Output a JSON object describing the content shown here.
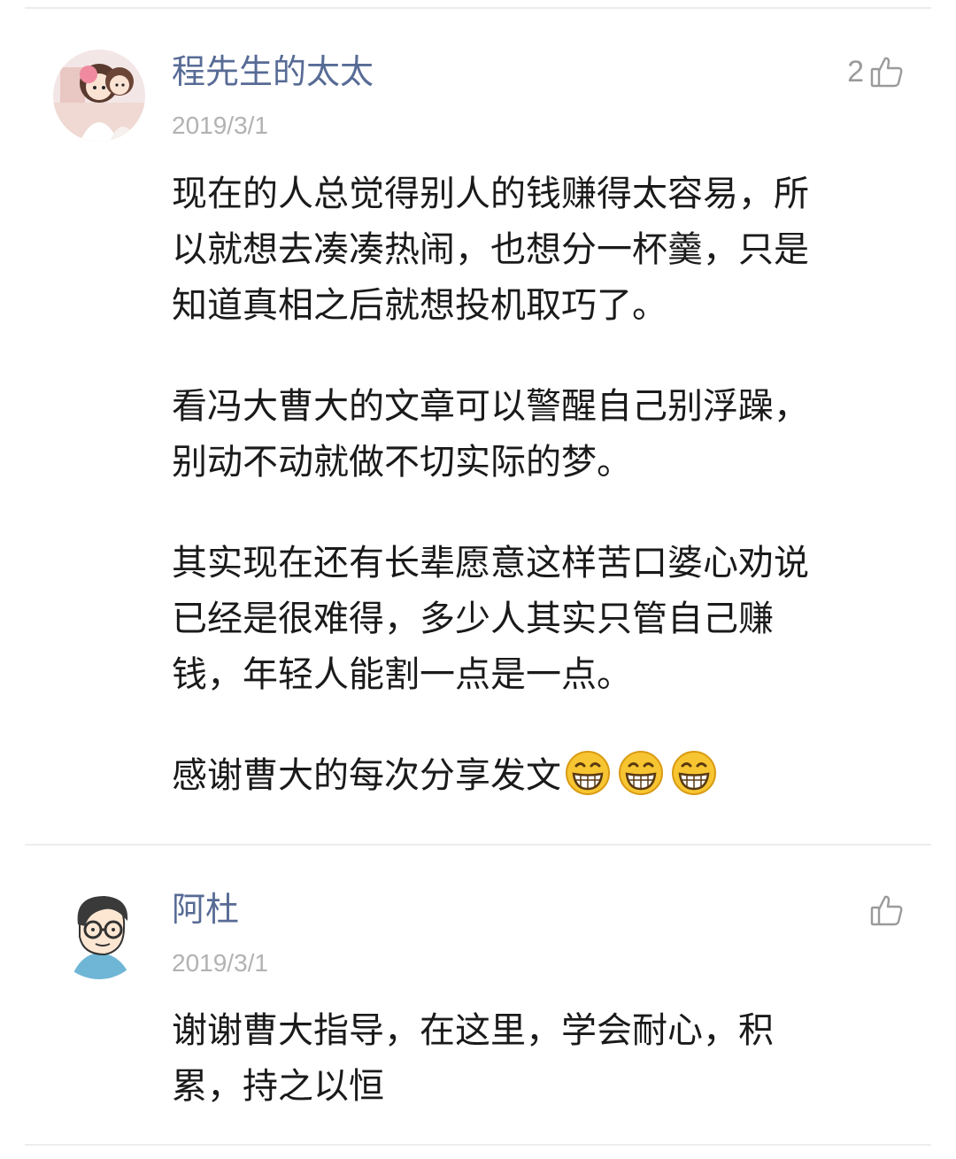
{
  "comments": [
    {
      "author": "程先生的太太",
      "date": "2019/3/1",
      "likes": "2",
      "avatar_icon": "cartoon-girls-avatar-icon",
      "paragraphs": [
        "现在的人总觉得别人的钱赚得太容易，所\n以就想去凑凑热闹，也想分一杯羹，只是\n知道真相之后就想投机取巧了。",
        "看冯大曹大的文章可以警醒自己别浮躁，\n别动不动就做不切实际的梦。",
        "其实现在还有长辈愿意这样苦口婆心劝说\n已经是很难得，多少人其实只管自己赚\n钱，年轻人能割一点是一点。",
        "感谢曹大的每次分享发文"
      ],
      "trailing_emoji": "grin-emoji-icon",
      "trailing_emoji_count": 3
    },
    {
      "author": "阿杜",
      "date": "2019/3/1",
      "likes": "",
      "avatar_icon": "cartoon-man-glasses-avatar-icon",
      "paragraphs": [
        "谢谢曹大指导，在这里，学会耐心，积\n累，持之以恒"
      ]
    }
  ],
  "colors": {
    "author": "#576b95",
    "date": "#b2b2b2",
    "text": "#1a1a1a",
    "like": "#9a9a9a",
    "divider": "#ededed"
  }
}
